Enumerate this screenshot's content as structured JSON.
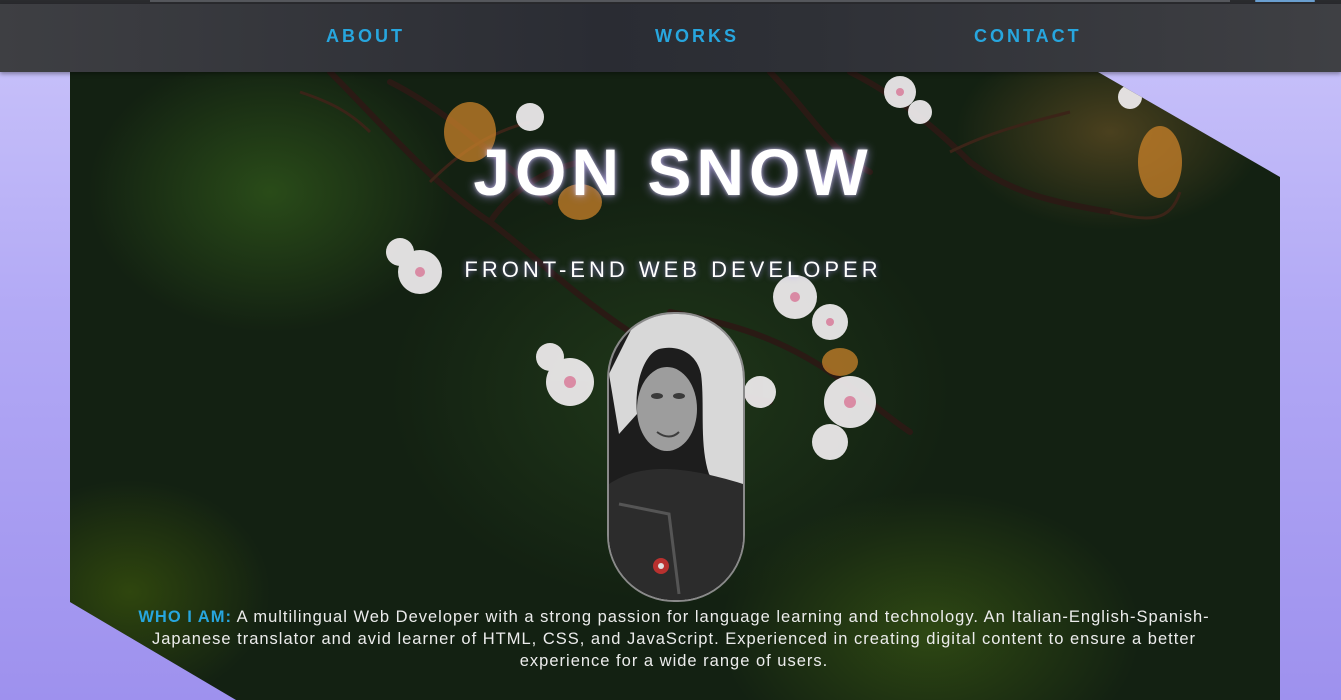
{
  "nav": {
    "about": "ABOUT",
    "works": "WORKS",
    "contact": "CONTACT"
  },
  "hero": {
    "name": "JON SNOW",
    "role": "FRONT-END WEB DEVELOPER",
    "portrait_icon": "profile-photo"
  },
  "about": {
    "label": "WHO I AM:",
    "text": " A multilingual Web Developer with a strong passion for language learning and technology. An Italian-English-Spanish-Japanese translator and avid learner of HTML, CSS, and JavaScript. Experienced in creating digital content to ensure a better experience for a wide range of users."
  },
  "colors": {
    "accent": "#27a6de",
    "nav_bg": "#333438",
    "page_bg": "#b2a9f5"
  }
}
